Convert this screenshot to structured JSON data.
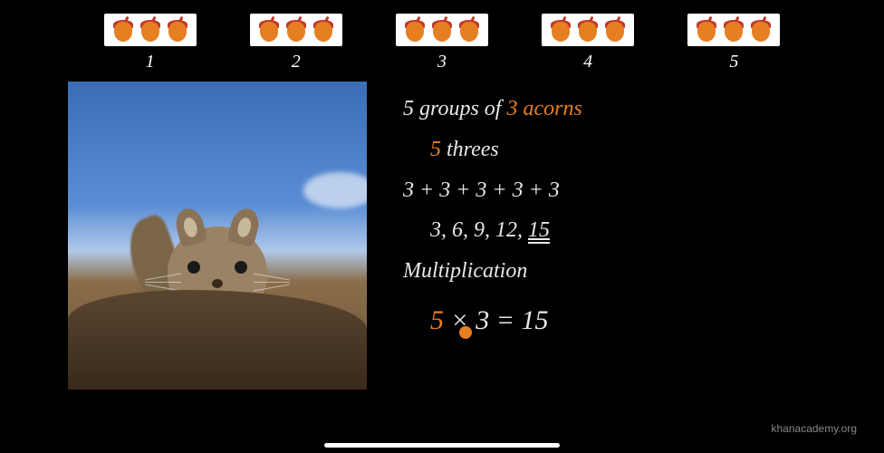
{
  "groups": {
    "count": 5,
    "acorns_per_group": 3,
    "labels": [
      "1",
      "2",
      "3",
      "4",
      "5"
    ]
  },
  "lesson": {
    "line1_a": "5 groups of ",
    "line1_b": "3 acorns",
    "line2_a": "5",
    "line2_b": " threes",
    "line3": "3 + 3 + 3 + 3 + 3",
    "line4_a": "3, 6, 9, 12, ",
    "line4_b": "15",
    "line5": "Multiplication",
    "line6_a": "5",
    "line6_b": " × 3 = 15"
  },
  "watermark": "khanacademy.org",
  "image": {
    "description": "squirrel-photo"
  }
}
